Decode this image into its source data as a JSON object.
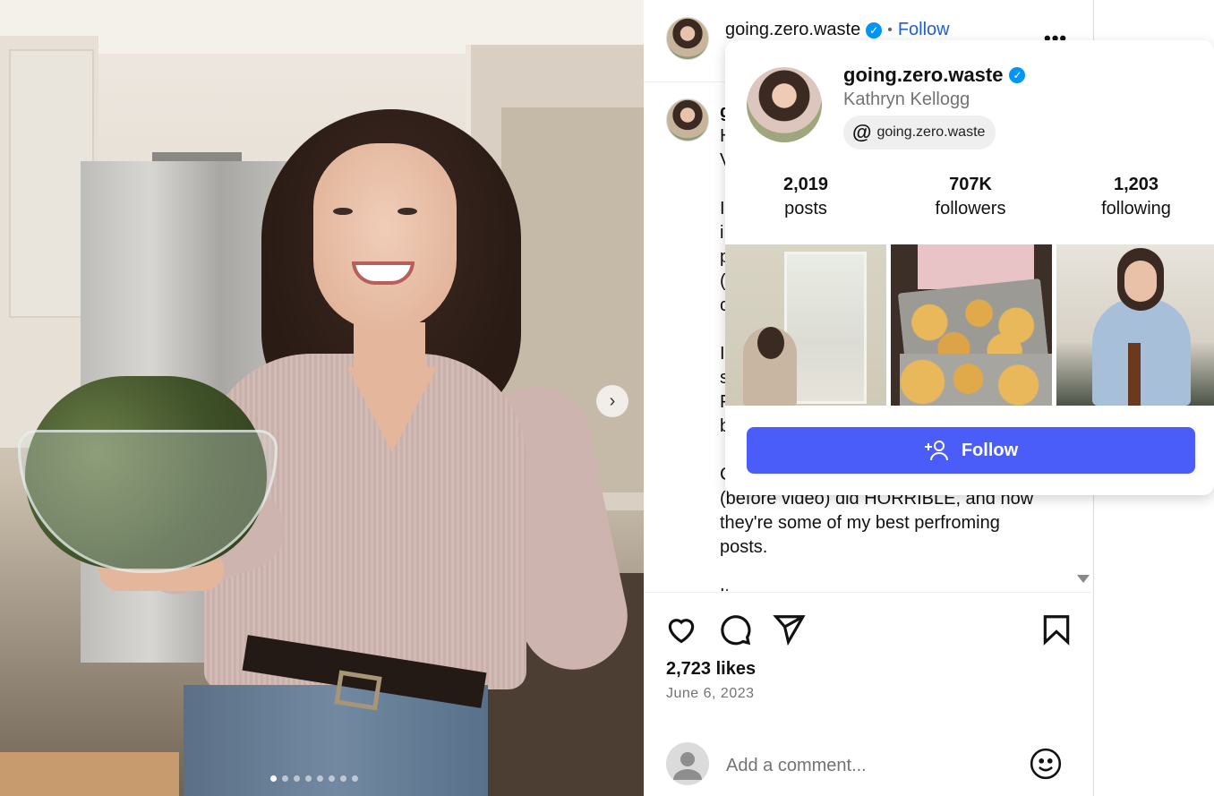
{
  "post": {
    "username": "going.zero.waste",
    "separator": "•",
    "follow_label": "Follow",
    "more_label": "•••",
    "caption_username_fragment": "g",
    "caption_lines": [
      "H",
      "V",
      "",
      "I",
      "i",
      "p",
      "(",
      "c",
      "",
      "I",
      "s",
      "F",
      "b",
      "",
      "C",
      "(before video) did HORRIBLE, and now",
      "they're some of my best perfroming",
      "posts.",
      "",
      "It"
    ],
    "likes": "2,723 likes",
    "date": "June 6, 2023",
    "comment_placeholder": "Add a comment...",
    "carousel_next_glyph": "›",
    "carousel_dots_count": 8,
    "carousel_active_index": 0
  },
  "hover_card": {
    "username": "going.zero.waste",
    "full_name": "Kathryn Kellogg",
    "threads_handle": "going.zero.waste",
    "stats": [
      {
        "value": "2,019",
        "label": "posts"
      },
      {
        "value": "707K",
        "label": "followers"
      },
      {
        "value": "1,203",
        "label": "following"
      }
    ],
    "follow_label": "Follow"
  },
  "colors": {
    "follow_link": "#1f5fd1",
    "verified": "#0095f6",
    "follow_button": "#4a5df9",
    "muted_text": "#737373"
  },
  "icons": {
    "like": "heart-icon",
    "comment": "comment-icon",
    "share": "send-icon",
    "save": "bookmark-icon",
    "emoji": "emoji-icon",
    "verified": "verified-badge-icon",
    "threads": "threads-icon",
    "add_user": "add-user-icon",
    "next": "chevron-right-icon",
    "more": "more-icon"
  }
}
